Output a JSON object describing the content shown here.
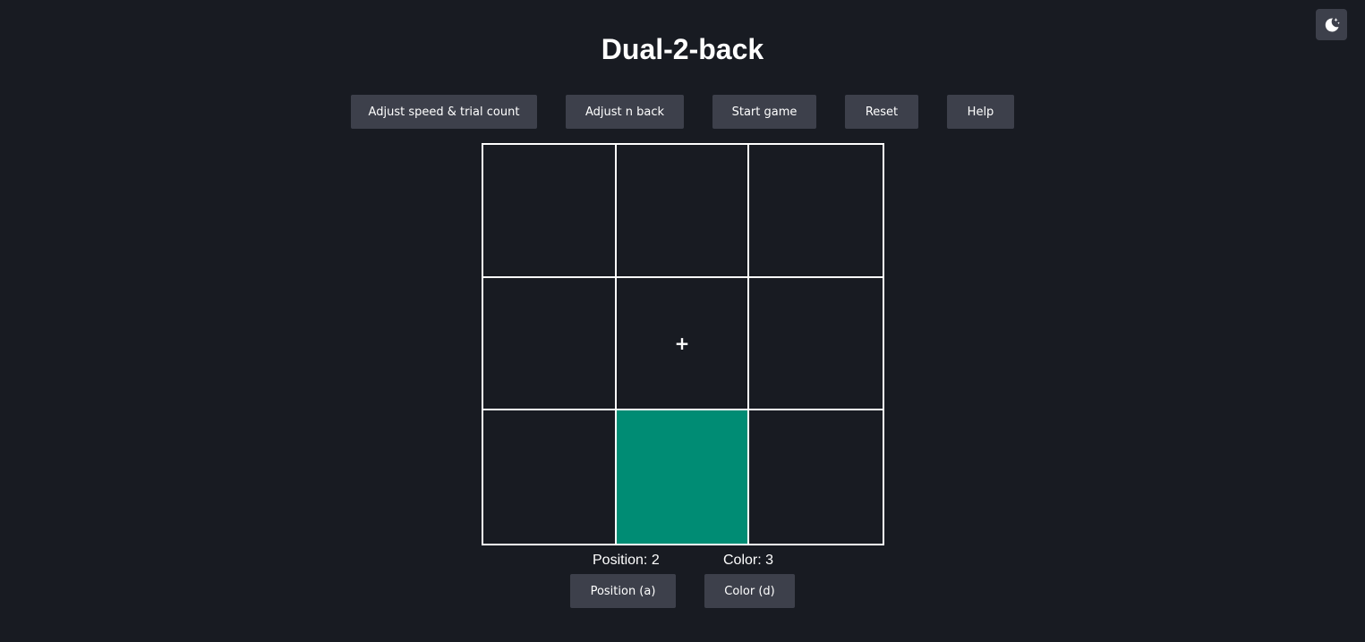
{
  "app": {
    "title": "Dual-2-back"
  },
  "toolbar": {
    "speed_label": "Adjust speed & trial count",
    "nback_label": "Adjust n back",
    "start_label": "Start game",
    "reset_label": "Reset",
    "help_label": "Help"
  },
  "theme_toggle": {
    "icon": "moon-stars-icon"
  },
  "board": {
    "rows": 3,
    "cols": 3,
    "active_cell": {
      "row": 3,
      "col": 2
    },
    "active_color": "#008c74",
    "center_mark": "+"
  },
  "scores": {
    "position_text": "Position: 2",
    "color_text": "Color: 3"
  },
  "responses": {
    "position_label": "Position (a)",
    "color_label": "Color (d)"
  },
  "colors": {
    "background": "#181b22",
    "button": "#3d404b",
    "grid_line": "#ffffff",
    "text": "#ffffff"
  }
}
